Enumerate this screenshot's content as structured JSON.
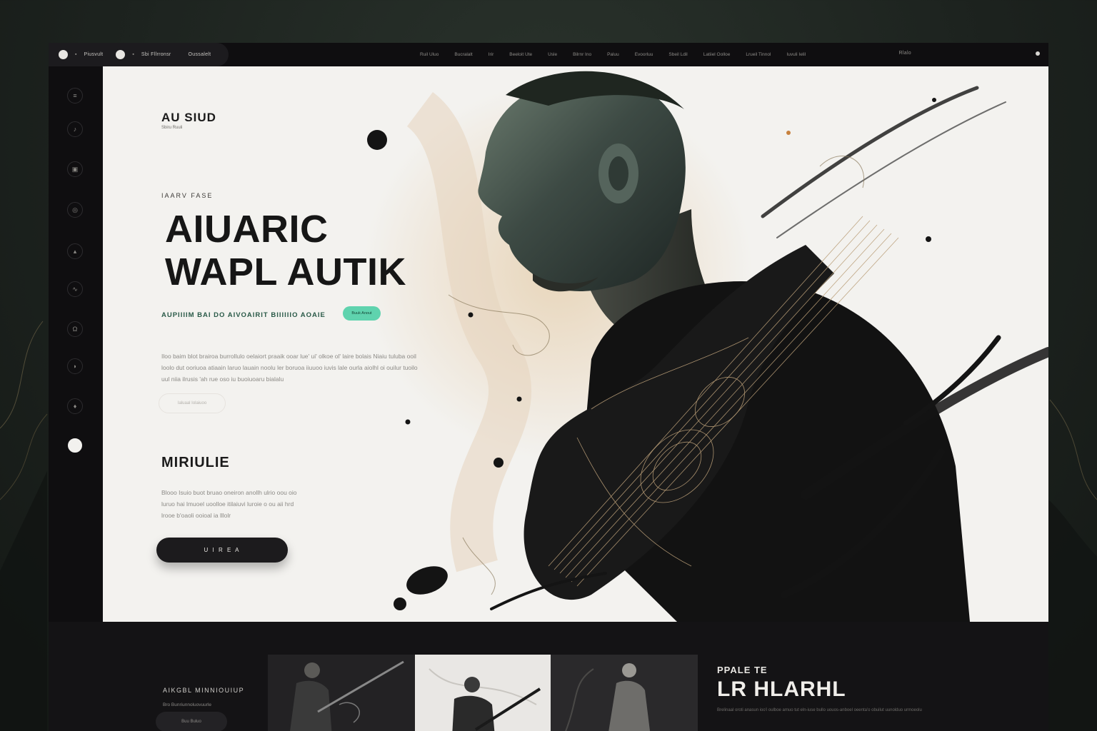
{
  "topbar": {
    "left_label_1": "Piusvult",
    "left_label_2": "Sbi  Fllrronsr",
    "left_label_3": "Oussalelt",
    "nav": [
      "Ruil Uluo",
      "Bucralalt",
      "Irir",
      "Beeloit Ute",
      "Usle",
      "Bilrnr Ino",
      "Paluu",
      "Evoorluu",
      "Sbeil Ldil",
      "Latiiel Oolloe",
      "Lrueil Tinnol",
      "Iuvuli Ielil"
    ],
    "right_label": "Rlalo"
  },
  "sidebar": {
    "icons": [
      "menu-icon",
      "music-note-icon",
      "album-icon",
      "radio-icon",
      "play-icon",
      "wave-icon",
      "headphones-icon",
      "mic-icon",
      "bell-icon",
      "active-dot"
    ]
  },
  "hero": {
    "brand": "AU SIUD",
    "brand_sub": "Sbiru Ruuli",
    "eyebrow": "IAARV FASE",
    "headline_line1": "AIUARIC",
    "headline_line2": "WAPL AUTIK",
    "tagline": "AUPIIIIM BAI DO AIVOAIRIT BIIIIIIO AOAIE",
    "accent_pill": "Buuk Anout",
    "body": "Iloo baim blot brairoa burrollulo oelaiort praaik ooar lue' ui' olkoe ol' laire bolais Niaiu tuluba ooil loolo dut ooriuoa atiaain laruo lauain noolu ler boruoa iiuuoo iuvis lale ourla aiolhl oi ouilur tuoilo uul niia ilrusis 'ah rue oso iu buoiuoaru bialalu",
    "ghost_button": "Ialuaal Iolaiuoo",
    "section_title": "MIRIULIE",
    "body_2": "Blooo Isuio buot bruao oneiron anollh ulrio oou oio luruo hai lmuoel uoolloe itilaiuvi luroie o ou aii hrd lrooe b'oaoli ooioal ia lllolr",
    "dark_button": "U  I  R  E  A"
  },
  "bottom": {
    "eyebrow": "AIKGBL MINNIOUIUP",
    "small": "Bro  Bunriunnoluovuurle",
    "pill": "Buu Buluo",
    "right_eyebrow": "PPALE TE",
    "right_title": "LR HLARHL",
    "right_small": "Brelinaal oroti anasun ioo'i oulboe amuo tut eln-iuse bullo uouos-anboel oeenta'o obuilut uunolduo urmoeolu"
  },
  "colors": {
    "accent": "#5fd3ae",
    "dark": "#141315",
    "hero_bg": "#f3f2ef"
  }
}
